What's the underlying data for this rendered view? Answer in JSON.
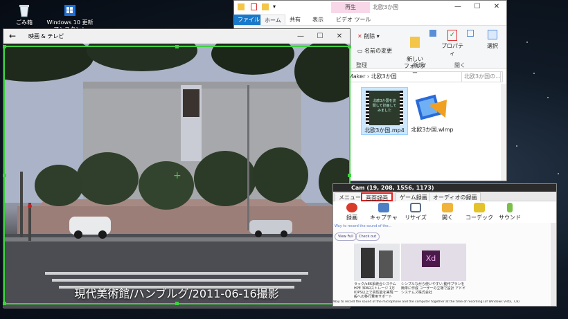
{
  "desktop": {
    "icons": [
      {
        "label": "ごみ箱",
        "icon": "recycle-bin-icon"
      },
      {
        "label": "Windows 10 更新アシスタント",
        "icon": "windows-update-icon"
      }
    ]
  },
  "explorer": {
    "context_tab": "再生",
    "title": "北欧3か国",
    "tabs": [
      "ファイル",
      "ホーム",
      "共有",
      "表示",
      "ビデオ ツール"
    ],
    "ribbon": {
      "delete": "削除",
      "rename": "名前の変更",
      "new_folder": "新しい\nフォルダー",
      "properties": "プロパティ",
      "select": "選択",
      "group_organize": "整理",
      "group_new": "新規",
      "group_open": "開く"
    },
    "address": "Maker › 北欧3か国",
    "search_placeholder": "北欧3か国の...",
    "files": [
      {
        "name": "北欧3か国.mp4",
        "thumb_text": "北欧3か国を訪問して計画してみました"
      },
      {
        "name": "北欧3か国.wlmp"
      }
    ]
  },
  "movie": {
    "title": "映画 & テレビ",
    "subtitle": "現代美術館/ハンブルグ/2011-06-16撮影"
  },
  "bandicam": {
    "title": "Cam (19, 208, 1556, 1173)",
    "tabs": [
      "メニュー",
      "画面録画",
      "ゲーム録画",
      "オーディオの録画"
    ],
    "tools": [
      "録画",
      "キャプチャ",
      "リサイズ",
      "開く",
      "コーデック",
      "サウンド"
    ],
    "body_line": "Way to record the sound of the...",
    "buttons": [
      "View Full",
      "Check out"
    ],
    "ad1_caption": "ラック/x86系統合システムHPE 3PARストレージ 1万IOPS以上で高性能を実現 一般への移行費用サポート",
    "ad2_caption": "シンプルながら使いやすい 動作プランを簡単に作成 ユーザーの立場で設計 アドビシステムズ株式会社",
    "ad2_badge": "Xd",
    "footer": "Way to record the sound of the microphone and the computer together at the time of recording (of Windows Vista, 7,8)"
  }
}
